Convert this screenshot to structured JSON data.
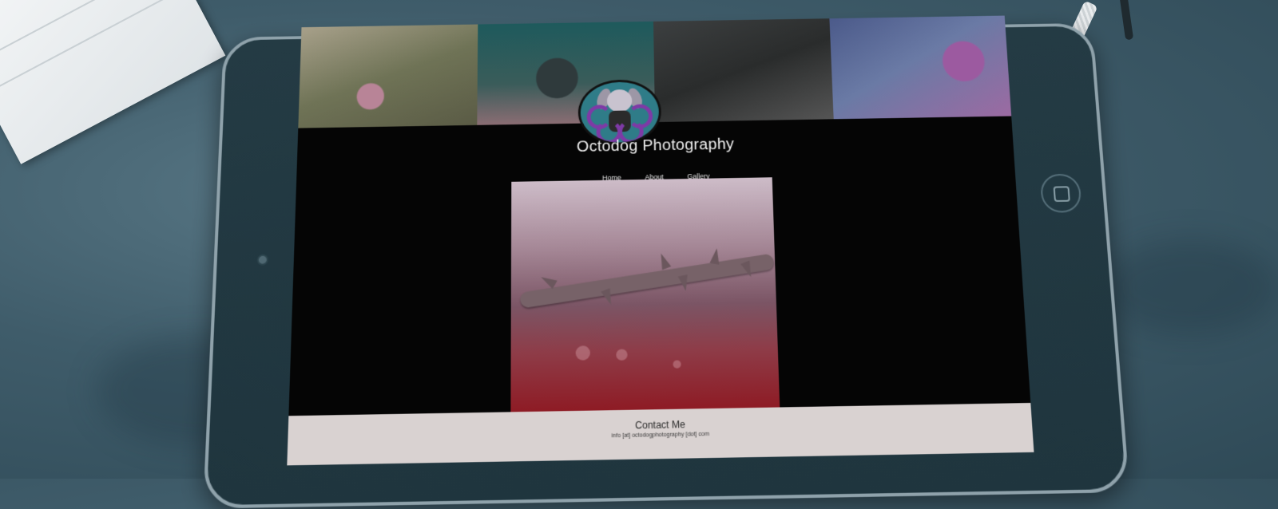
{
  "site": {
    "title": "Octodog Photography"
  },
  "nav": {
    "items": [
      {
        "label": "Home"
      },
      {
        "label": "About"
      },
      {
        "label": "Gallery"
      }
    ]
  },
  "footer": {
    "title": "Contact Me",
    "email": "info [at] octodogphotography [dot] com"
  },
  "icons": {
    "logo": "octodog-logo-icon",
    "camera": "camera-icon",
    "home_button": "home-button-icon"
  },
  "colors": {
    "screen_bg": "#050505",
    "footer_bg": "#d9d2d1",
    "logo_bg": "#2f7c88",
    "logo_accent": "#7e3aa6"
  }
}
